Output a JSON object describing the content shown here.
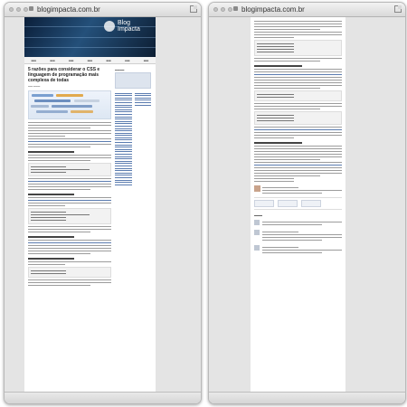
{
  "windows": [
    {
      "url": "blogimpacta.com.br"
    },
    {
      "url": "blogimpacta.com.br"
    }
  ],
  "blog": {
    "logo_line1": "Blog",
    "logo_line2": "Impacta"
  },
  "article": {
    "title": "5 razões para considerar o CSS e linguagem de programação mais complexa de todas"
  }
}
